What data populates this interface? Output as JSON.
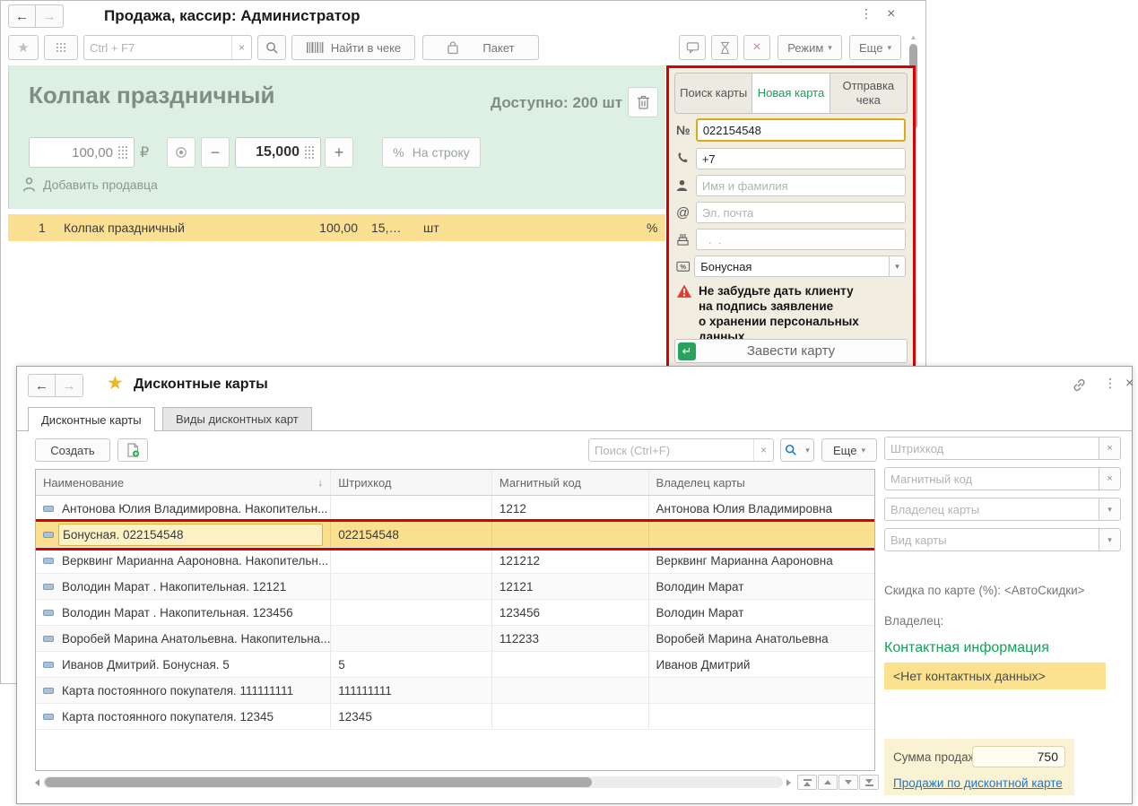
{
  "glyphs": {
    "back": "←",
    "forward": "→",
    "close": "×",
    "kebab": "⋮",
    "dropdown": "▾",
    "sort_down": "↓",
    "star": "★",
    "enter": "↵",
    "minus": "−",
    "plus": "+",
    "clear": "×",
    "percent": "%",
    "at": "@",
    "number_sign": "№"
  },
  "colors": {
    "highlight_red": "#d50000",
    "accent_green": "#12a258",
    "selected_yellow": "#fbdf92",
    "panel_beige": "#f1eee1",
    "panel_mint": "#def0e4",
    "link_blue": "#2076c7"
  },
  "sale_window": {
    "title": "Продажа, кассир: Администратор",
    "toolbar": {
      "quick_search_placeholder": "Ctrl + F7",
      "find_in_receipt": "Найти в чеке",
      "package": "Пакет",
      "mode": "Режим",
      "more": "Еще"
    },
    "product": {
      "name": "Колпак праздничный",
      "available": "Доступно: 200 шт",
      "price": "100,00",
      "currency": "₽",
      "quantity": "15,000",
      "discount_button": "На строку",
      "add_seller": "Добавить продавца"
    },
    "receipt_row": {
      "num": "1",
      "name": "Колпак праздничный",
      "price": "100,00",
      "total": "15,…",
      "unit": "шт"
    },
    "card_panel": {
      "tab_search": "Поиск карты",
      "tab_new": "Новая карта",
      "tab_send": "Отправка чека",
      "card_number": "022154548",
      "phone": "+7",
      "name_placeholder": "Имя и фамилия",
      "email_placeholder": "Эл. почта",
      "birthday_placeholder": "  .  .",
      "card_type": "Бонусная",
      "warning": "Не забудьте дать клиенту\nна подпись заявление\nо хранении персональных\nданных.",
      "create_card": "Завести карту"
    }
  },
  "cards_window": {
    "title": "Дисконтные карты",
    "tab_cards": "Дисконтные карты",
    "tab_types": "Виды дисконтных карт",
    "toolbar": {
      "create": "Создать",
      "search_placeholder": "Поиск (Ctrl+F)",
      "more": "Еще"
    },
    "table": {
      "col_name": "Наименование",
      "col_barcode": "Штрихкод",
      "col_magnetic": "Магнитный код",
      "col_owner": "Владелец карты",
      "rows": [
        {
          "name": "Антонова Юлия Владимировна. Накопительн...",
          "barcode": "",
          "magnetic": "1212",
          "owner": "Антонова Юлия Владимировна"
        },
        {
          "name": "Бонусная. 022154548",
          "barcode": "022154548",
          "magnetic": "",
          "owner": ""
        },
        {
          "name": "Верквинг Марианна Аароновна. Накопительн...",
          "barcode": "",
          "magnetic": "121212",
          "owner": "Верквинг Марианна Аароновна"
        },
        {
          "name": "Володин Марат . Накопительная. 12121",
          "barcode": "",
          "magnetic": "12121",
          "owner": "Володин Марат"
        },
        {
          "name": "Володин Марат . Накопительная. 123456",
          "barcode": "",
          "magnetic": "123456",
          "owner": "Володин Марат"
        },
        {
          "name": "Воробей Марина Анатольевна. Накопительна...",
          "barcode": "",
          "magnetic": "112233",
          "owner": "Воробей Марина Анатольевна"
        },
        {
          "name": "Иванов Дмитрий. Бонусная. 5",
          "barcode": "5",
          "magnetic": "",
          "owner": "Иванов Дмитрий"
        },
        {
          "name": "Карта постоянного покупателя. 111111111",
          "barcode": "111111111",
          "magnetic": "",
          "owner": ""
        },
        {
          "name": "Карта постоянного покупателя. 12345",
          "barcode": "12345",
          "magnetic": "",
          "owner": ""
        }
      ]
    },
    "filters": {
      "barcode_placeholder": "Штрихкод",
      "magnetic_placeholder": "Магнитный код",
      "owner_placeholder": "Владелец карты",
      "type_placeholder": "Вид карты"
    },
    "details": {
      "discount_label": "Скидка по карте (%):",
      "discount_value": "<АвтоСкидки>",
      "owner_label": "Владелец:",
      "contacts_header": "Контактная информация",
      "no_contacts": "<Нет контактных данных>",
      "sales_sum_label": "Сумма продаж:",
      "sales_sum": "750",
      "sales_link": "Продажи по дисконтной карте"
    }
  }
}
